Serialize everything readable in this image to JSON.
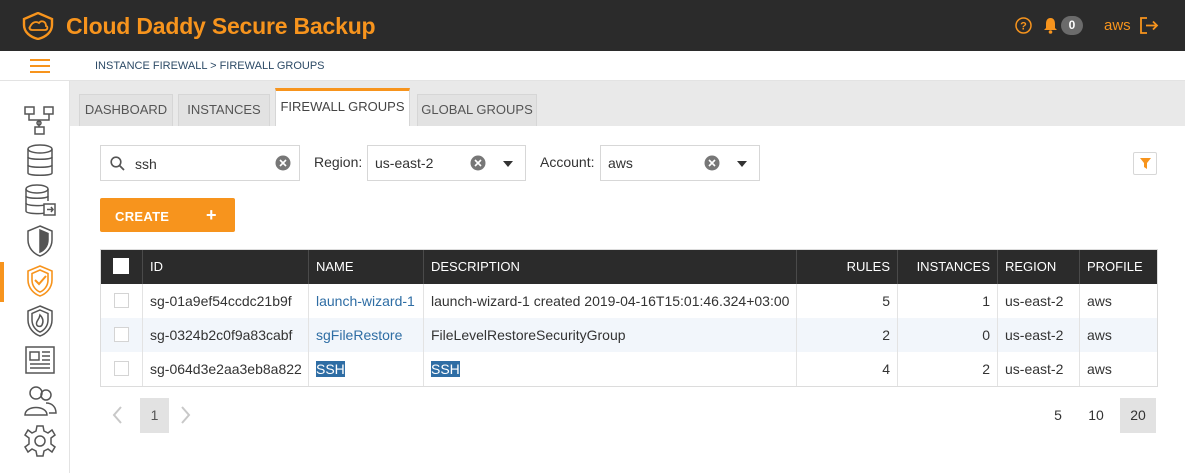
{
  "app": {
    "title": "Cloud Daddy Secure Backup",
    "notifications_count": "0",
    "user": "aws"
  },
  "breadcrumb": "INSTANCE FIREWALL > FIREWALL GROUPS",
  "sidebar": {
    "items": [
      {
        "icon": "network-icon"
      },
      {
        "icon": "database-icon"
      },
      {
        "icon": "database-export-icon"
      },
      {
        "icon": "shield-icon"
      },
      {
        "icon": "shield-check-icon",
        "active": true
      },
      {
        "icon": "shield-fire-icon"
      },
      {
        "icon": "report-icon"
      },
      {
        "icon": "users-icon"
      },
      {
        "icon": "settings-gear-icon"
      }
    ]
  },
  "tabs": [
    {
      "label": "DASHBOARD"
    },
    {
      "label": "INSTANCES"
    },
    {
      "label": "FIREWALL GROUPS",
      "active": true
    },
    {
      "label": "GLOBAL GROUPS"
    }
  ],
  "filters": {
    "search": "ssh",
    "region_label": "Region:",
    "region_value": "us-east-2",
    "account_label": "Account:",
    "account_value": "aws"
  },
  "create_label": "CREATE",
  "table": {
    "columns": [
      "ID",
      "NAME",
      "DESCRIPTION",
      "RULES",
      "INSTANCES",
      "REGION",
      "PROFILE"
    ],
    "rows": [
      {
        "id": "sg-01a9ef54ccdc21b9f",
        "name": "launch-wizard-1",
        "description": "launch-wizard-1 created 2019-04-16T15:01:46.324+03:00",
        "rules": "5",
        "instances": "1",
        "region": "us-east-2",
        "profile": "aws"
      },
      {
        "id": "sg-0324b2c0f9a83cabf",
        "name": "sgFileRestore",
        "description": "FileLevelRestoreSecurityGroup",
        "rules": "2",
        "instances": "0",
        "region": "us-east-2",
        "profile": "aws"
      },
      {
        "id": "sg-064d3e2aa3eb8a822",
        "name": "SSH",
        "description": "SSH",
        "rules": "4",
        "instances": "2",
        "region": "us-east-2",
        "profile": "aws"
      }
    ]
  },
  "pagination": {
    "current_page": "1",
    "page_sizes": [
      "5",
      "10",
      "20"
    ],
    "selected_size": "20"
  },
  "colors": {
    "brand": "#f7941d",
    "header_bg": "#2b2b2b",
    "link": "#2e6da4"
  }
}
